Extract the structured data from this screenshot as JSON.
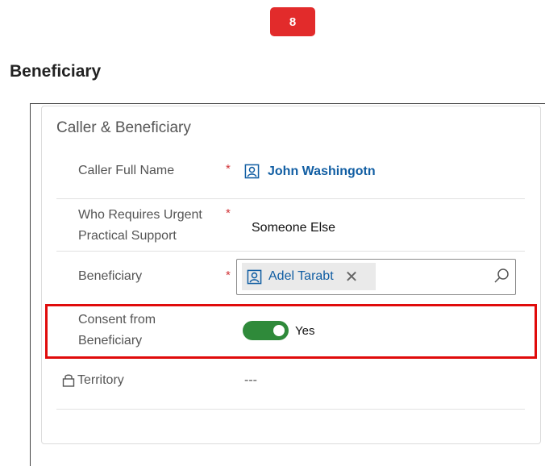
{
  "step_badge": "8",
  "section_heading": "Beneficiary",
  "card": {
    "title": "Caller & Beneficiary",
    "fields": {
      "caller_full_name": {
        "label": "Caller Full Name",
        "required": "*",
        "value": "John Washingotn",
        "icon": "contact-icon"
      },
      "who_requires": {
        "label_line1": "Who Requires Urgent",
        "label_line2": "Practical Support",
        "required": "*",
        "value": "Someone Else"
      },
      "beneficiary": {
        "label": "Beneficiary",
        "required": "*",
        "value": "Adel Tarabt",
        "remove": "✕",
        "icon": "contact-icon",
        "search_icon": "search-icon"
      },
      "consent": {
        "label_line1": "Consent from",
        "label_line2": "Beneficiary",
        "value": "Yes",
        "toggle_on": true
      },
      "territory": {
        "label": "Territory",
        "value": "---",
        "icon": "lock-icon"
      }
    }
  },
  "colors": {
    "badge": "#e22b2b",
    "highlight": "#e00b0b",
    "toggle": "#2f8a3a",
    "link": "#115ea3",
    "required": "#d13438"
  }
}
